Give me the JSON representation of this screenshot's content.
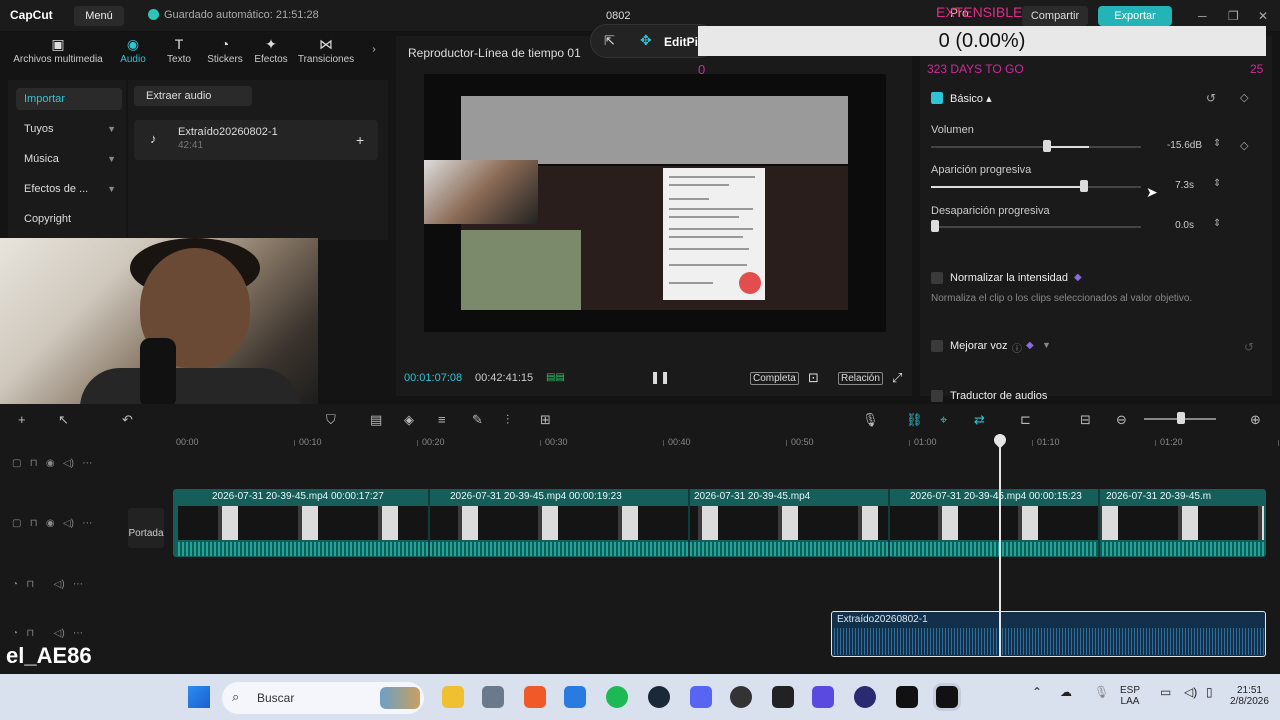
{
  "app": {
    "logo": "CapCut",
    "menu": "Menú",
    "autosave": "Guardado automático: 21:51:28",
    "project_title": "0802",
    "pro": "Pro",
    "share": "Compartir",
    "export": "Exportar"
  },
  "left_tabs": [
    {
      "label": "Archivos multimedia",
      "icon": "media-icon"
    },
    {
      "label": "Audio",
      "icon": "audio-icon"
    },
    {
      "label": "Texto",
      "icon": "text-icon"
    },
    {
      "label": "Stickers",
      "icon": "sticker-icon"
    },
    {
      "label": "Efectos",
      "icon": "effects-icon"
    },
    {
      "label": "Transiciones",
      "icon": "transitions-icon"
    }
  ],
  "left_nav": [
    "Importar",
    "Tuyos",
    "Música",
    "Efectos de ...",
    "Copyright"
  ],
  "extract_audio": "Extraer audio",
  "asset": {
    "name": "Extraído20260802-1",
    "duration": "42:41"
  },
  "player": {
    "title": "Reproductor-Línea de tiempo 01",
    "editpi": "EditPi",
    "time_current": "00:01:07:08",
    "time_total": "00:42:41:15",
    "btn_full": "Completa",
    "btn_ratio": "Relación"
  },
  "overlay": {
    "counter": "0 (0.00%)",
    "extensible": "EXTENSIBLE",
    "days_to_go": "323 DAYS TO GO",
    "days_num": "25",
    "zero": "0"
  },
  "inspector": {
    "section": "Básico",
    "volume_label": "Volumen",
    "volume_value": "-15.6dB",
    "volume_level": 0.77,
    "fadein_label": "Aparición progresiva",
    "fadein_value": "7.3s",
    "fadein_level": 0.73,
    "fadeout_label": "Desaparición progresiva",
    "fadeout_value": "0.0s",
    "fadeout_level": 0.0,
    "normalize_label": "Normalizar la intensidad",
    "normalize_desc": "Normaliza el clip o los clips seleccionados al valor objetivo.",
    "enhance_label": "Mejorar voz",
    "translate_label": "Traductor de audios"
  },
  "timeline": {
    "ruler": [
      "00:00",
      "00:10",
      "00:20",
      "00:30",
      "00:40",
      "00:50",
      "01:00",
      "01:10",
      "01:20"
    ],
    "clips": [
      {
        "label": "2026-07-31 20-39-45.mp4  00:00:17:27"
      },
      {
        "label": "2026-07-31 20-39-45.mp4  00:00:19:23"
      },
      {
        "label": "2026-07-31 20-39-45.mp4"
      },
      {
        "label": "2026-07-31 20-39-45.mp4  00:00:15:23"
      },
      {
        "label": "2026-07-31 20-39-45.m"
      }
    ],
    "portada": "Portada",
    "audio_clip": "Extraído20260802-1"
  },
  "watermark": "el_AE86",
  "taskbar": {
    "search": "Buscar",
    "lang": "ESP",
    "lang2": "LAA",
    "time": "21:51",
    "date": "2/8/2026"
  }
}
